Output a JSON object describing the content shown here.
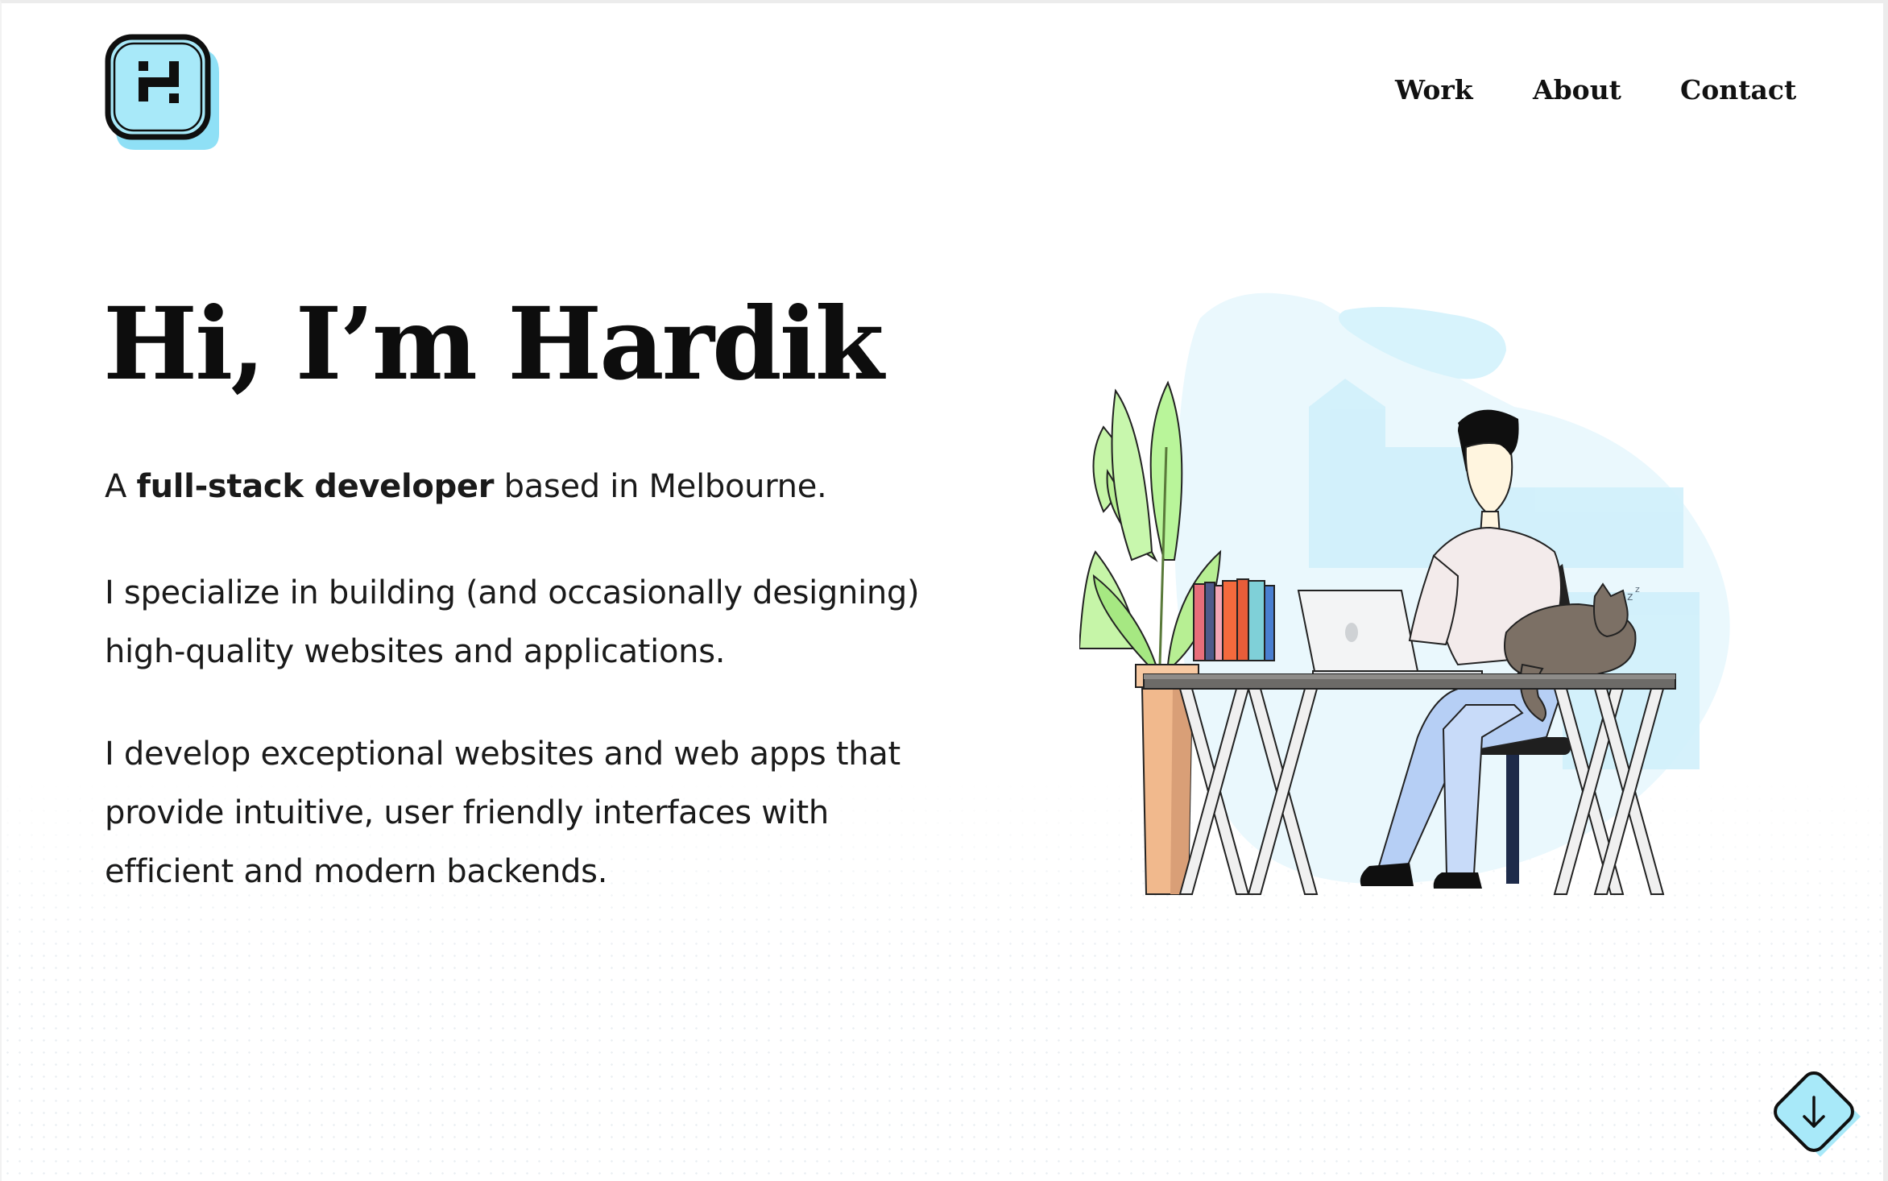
{
  "header": {
    "logo_alt": "HK logo",
    "nav": [
      {
        "label": "Work"
      },
      {
        "label": "About"
      },
      {
        "label": "Contact"
      }
    ]
  },
  "hero": {
    "title": "Hi, I’m Hardik",
    "intro_prefix": "A ",
    "intro_bold": "full-stack developer",
    "intro_suffix": " based in Melbourne.",
    "paragraph_1": "I specialize in building (and occasionally designing) high-quality websites and applications.",
    "paragraph_2": "I develop exceptional websites and web apps that provide intuitive, user friendly interfaces with efficient and modern backends."
  },
  "scroll_button": {
    "icon": "arrow-down-icon"
  },
  "colors": {
    "accent": "#9be4f7",
    "text": "#111111",
    "illustration_bg": "#e6f7fd"
  }
}
